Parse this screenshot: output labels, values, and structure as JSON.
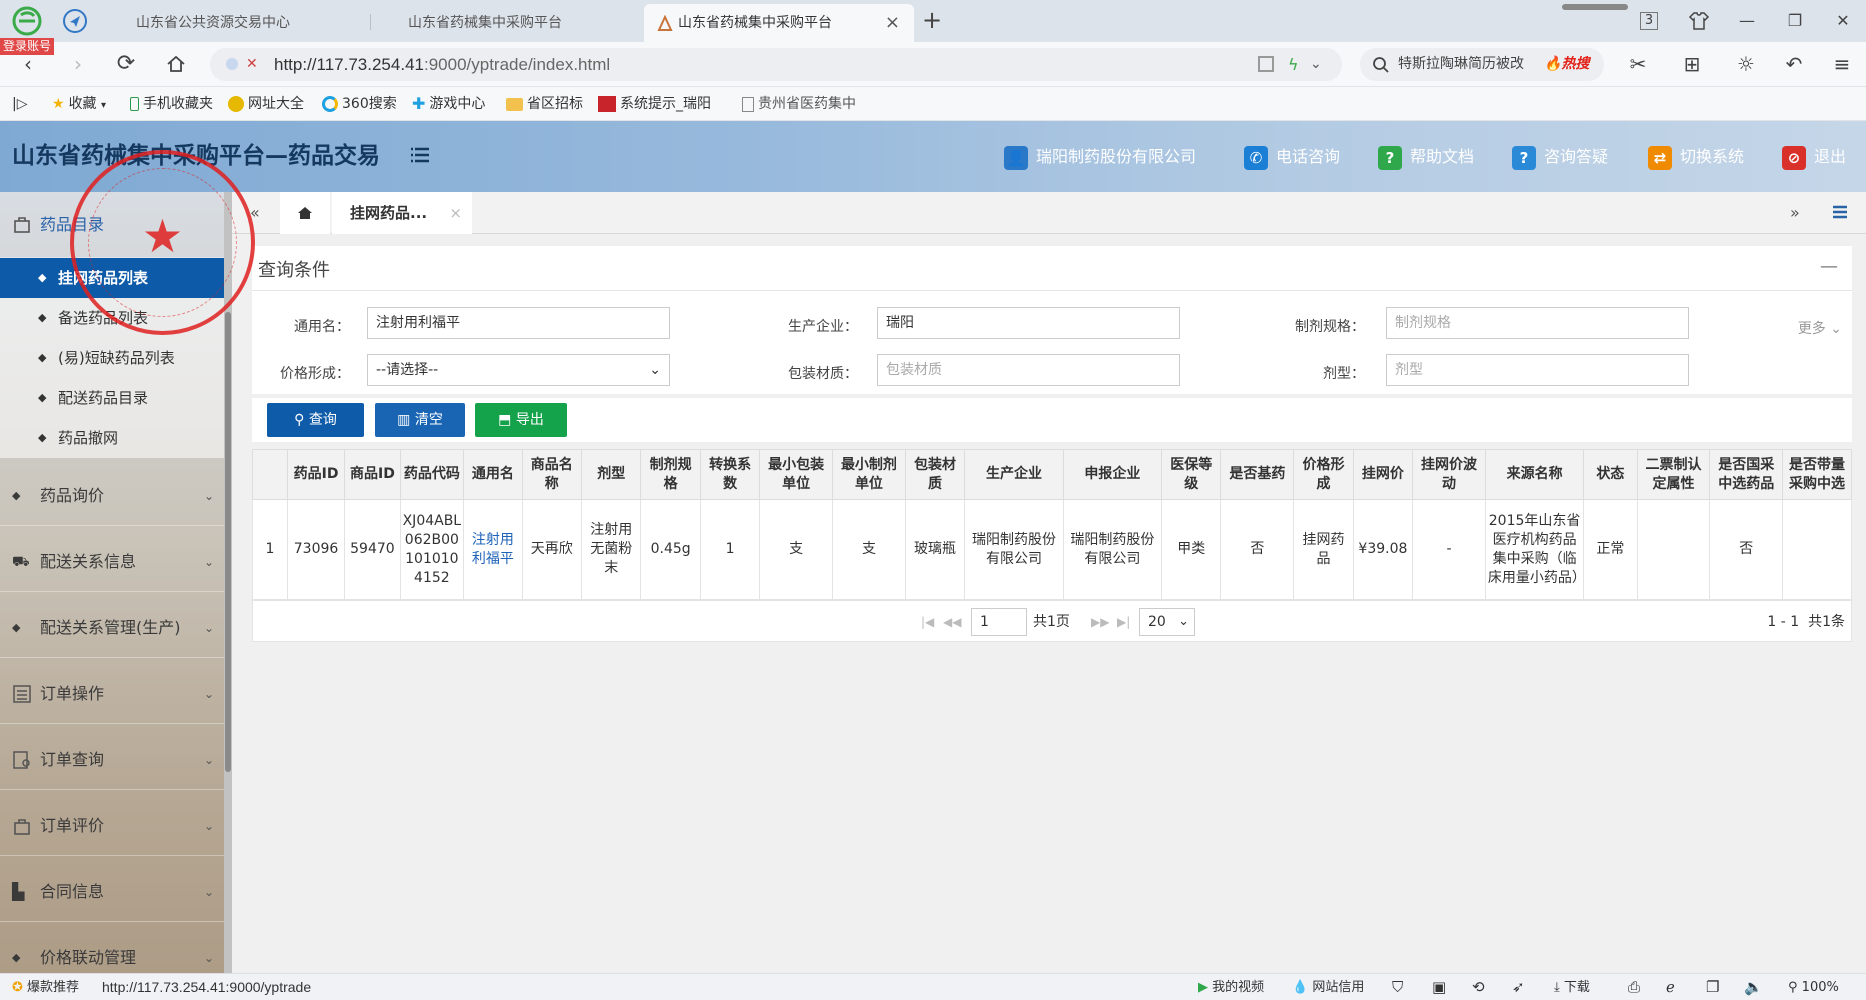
{
  "browser": {
    "tabs": [
      {
        "title": "山东省公共资源交易中心"
      },
      {
        "title": "山东省药械集中采购平台"
      },
      {
        "title": "山东省药械集中采购平台",
        "active": true
      }
    ],
    "login_badge": "登录账号",
    "tab_count": "3",
    "url_host": "http://117.73.254.41",
    "url_path": ":9000/yptrade/index.html",
    "search_text": "特斯拉陶琳简历被改",
    "search_hot": "热搜",
    "bookmarks": [
      "收藏",
      "手机收藏夹",
      "网址大全",
      "360搜索",
      "游戏中心",
      "省区招标",
      "系统提示_瑞阳",
      "贵州省医药集中"
    ]
  },
  "app": {
    "title": "山东省药械集中采购平台—药品交易",
    "header_items": [
      {
        "label": "瑞阳制药股份有限公司",
        "color": "#2a78c8",
        "icon": "user-icon"
      },
      {
        "label": "电话咨询",
        "color": "#1c7fd6",
        "icon": "phone-icon"
      },
      {
        "label": "帮助文档",
        "color": "#2ea84a",
        "icon": "help-icon"
      },
      {
        "label": "咨询答疑",
        "color": "#2a8ad8",
        "icon": "question-icon"
      },
      {
        "label": "切换系统",
        "color": "#f08a00",
        "icon": "switch-icon"
      },
      {
        "label": "退出",
        "color": "#d9302a",
        "icon": "logout-icon"
      }
    ]
  },
  "sidebar": {
    "sections": [
      {
        "label": "药品目录"
      },
      {
        "label": "药品询价"
      },
      {
        "label": "配送关系信息"
      },
      {
        "label": "配送关系管理(生产)"
      },
      {
        "label": "订单操作"
      },
      {
        "label": "订单查询"
      },
      {
        "label": "订单评价"
      },
      {
        "label": "合同信息"
      },
      {
        "label": "价格联动管理"
      }
    ],
    "sub_items": [
      {
        "label": "挂网药品列表",
        "active": true
      },
      {
        "label": "备选药品列表"
      },
      {
        "label": "(易)短缺药品列表"
      },
      {
        "label": "配送药品目录"
      },
      {
        "label": "药品撤网"
      }
    ]
  },
  "main": {
    "tab_label": "挂网药品...",
    "query_title": "查询条件",
    "more_label": "更多",
    "fields": [
      {
        "label": "通用名：",
        "value": "注射用利福平",
        "placeholder": ""
      },
      {
        "label": "生产企业：",
        "value": "瑞阳",
        "placeholder": ""
      },
      {
        "label": "制剂规格：",
        "value": "",
        "placeholder": "制剂规格"
      },
      {
        "label": "价格形成：",
        "value": "--请选择--",
        "placeholder": ""
      },
      {
        "label": "包装材质：",
        "value": "",
        "placeholder": "包装材质"
      },
      {
        "label": "剂型：",
        "value": "",
        "placeholder": "剂型"
      }
    ],
    "buttons": {
      "query": "查询",
      "clear": "清空",
      "export": "导出"
    },
    "table": {
      "columns": [
        "",
        "药品ID",
        "商品ID",
        "药品代码",
        "通用名",
        "商品名称",
        "剂型",
        "制剂规格",
        "转换系数",
        "最小包装单位",
        "最小制剂单位",
        "包装材质",
        "生产企业",
        "申报企业",
        "医保等级",
        "是否基药",
        "价格形成",
        "挂网价",
        "挂网价波动",
        "来源名称",
        "状态",
        "二票制认定属性",
        "是否国采中选药品",
        "是否带量采购中选"
      ],
      "rows": [
        [
          "1",
          "73096",
          "59470",
          "XJ04ABL062B001010104152",
          "注射用利福平",
          "天再欣",
          "注射用无菌粉末",
          "0.45g",
          "1",
          "支",
          "支",
          "玻璃瓶",
          "瑞阳制药股份有限公司",
          "瑞阳制药股份有限公司",
          "甲类",
          "否",
          "挂网药品",
          "¥39.08",
          "-",
          "2015年山东省医疗机构药品集中采购（临床用量小药品）",
          "正常",
          "",
          "否",
          ""
        ]
      ]
    },
    "pager": {
      "page": "1",
      "total_pages": "共1页",
      "page_size": "20",
      "summary": "1 - 1  共1条"
    }
  },
  "statusbar": {
    "left_label": "爆款推荐",
    "url": "http://117.73.254.41:9000/yptrade",
    "items": [
      "我的视频",
      "网站信用",
      "下载"
    ],
    "zoom": "100%"
  }
}
